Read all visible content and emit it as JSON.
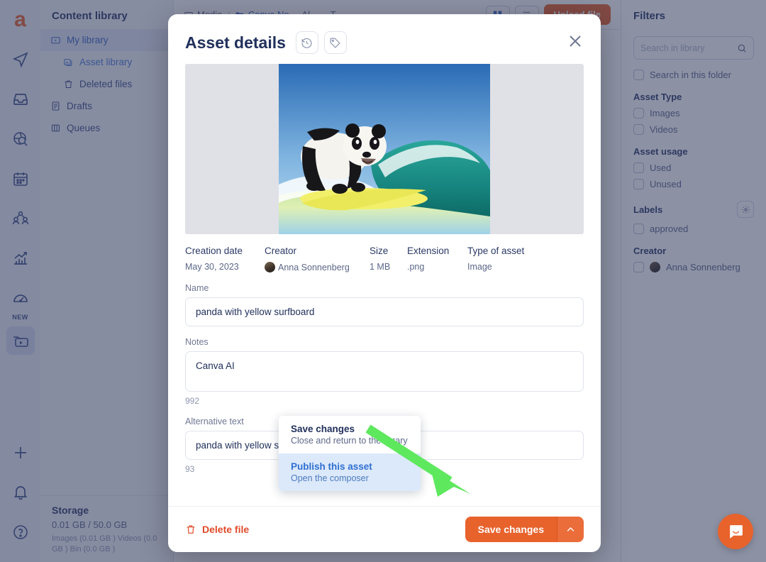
{
  "rail": {
    "logo": "a",
    "items": [
      {
        "name": "publish-icon",
        "label": "Publish"
      },
      {
        "name": "inbox-icon",
        "label": "Inbox"
      },
      {
        "name": "monitoring-icon",
        "label": "Monitoring"
      },
      {
        "name": "calendar-icon",
        "label": "Calendar"
      },
      {
        "name": "team-icon",
        "label": "Team"
      },
      {
        "name": "analytics-icon",
        "label": "Analytics"
      },
      {
        "name": "dashboard-icon",
        "label": "Dashboard"
      },
      {
        "name": "media-library-icon",
        "label": "Content library"
      }
    ],
    "new_badge": "NEW",
    "bottom_items": [
      {
        "name": "add-icon",
        "label": "Add"
      },
      {
        "name": "notifications-icon",
        "label": "Notifications"
      },
      {
        "name": "help-icon",
        "label": "Help"
      }
    ]
  },
  "sidebar": {
    "title": "Content library",
    "items": [
      {
        "label": "My library",
        "icon": "library-icon"
      },
      {
        "label": "Asset library",
        "icon": "images-icon"
      },
      {
        "label": "Deleted files",
        "icon": "trash-icon"
      },
      {
        "label": "Drafts",
        "icon": "drafts-icon"
      },
      {
        "label": "Queues",
        "icon": "queues-icon"
      }
    ],
    "storage": {
      "title": "Storage",
      "value": "0.01 GB / 50.0 GB",
      "detail": "Images (0.01 GB ) Videos (0.0 GB ) Bin (0.0 GB )"
    }
  },
  "topbar": {
    "crumb_media": "Media",
    "crumb_folder": "Canva Ne...",
    "crumb_tail": "Al... ... T...",
    "grid_view": "grid-view",
    "list_view": "list-view",
    "primary_button": "Upload file"
  },
  "filters": {
    "title": "Filters",
    "search_placeholder": "Search in library",
    "search_folder_label": "Search in this folder",
    "groups": [
      {
        "heading": "Asset Type",
        "options": [
          "Images",
          "Videos"
        ]
      },
      {
        "heading": "Asset usage",
        "options": [
          "Used",
          "Unused"
        ]
      },
      {
        "heading": "Labels",
        "options": [
          "approved"
        ],
        "has_gear": true
      },
      {
        "heading": "Creator",
        "options": [
          "Anna Sonnenberg"
        ],
        "has_avatar": true
      }
    ]
  },
  "modal": {
    "title": "Asset details",
    "history_icon": "history-icon",
    "tag_icon": "tag-icon",
    "close_icon": "close-icon",
    "preview_alt": "panda with yellow surfboard",
    "meta": [
      {
        "header": "Creation date",
        "value": "May 30, 2023"
      },
      {
        "header": "Creator",
        "value": "Anna Sonnenberg"
      },
      {
        "header": "Size",
        "value": "1 MB"
      },
      {
        "header": "Extension",
        "value": ".png"
      },
      {
        "header": "Type of asset",
        "value": "Image"
      }
    ],
    "fields": [
      {
        "label": "Name",
        "value": "panda with yellow surfboard"
      },
      {
        "label": "Notes",
        "value": "Canva AI",
        "counter": "992"
      },
      {
        "label": "Alternative text",
        "value": "panda with yellow surfboard",
        "counter": "93"
      }
    ],
    "footer": {
      "delete_label": "Delete file",
      "save_label": "Save changes",
      "dropdown_icon": "chevron-up-icon"
    },
    "dropdown": [
      {
        "title": "Save changes",
        "subtitle": "Close and return to the library",
        "highlighted": false
      },
      {
        "title": "Publish this asset",
        "subtitle": "Open the composer",
        "highlighted": true
      }
    ]
  },
  "chat": {
    "icon": "chat-bubble-icon"
  },
  "colors": {
    "accent_orange": "#e8622c",
    "link_blue": "#3a67c4",
    "navy": "#21305c",
    "annotation_green": "#5ee85e",
    "delete_red": "#e04a29"
  }
}
